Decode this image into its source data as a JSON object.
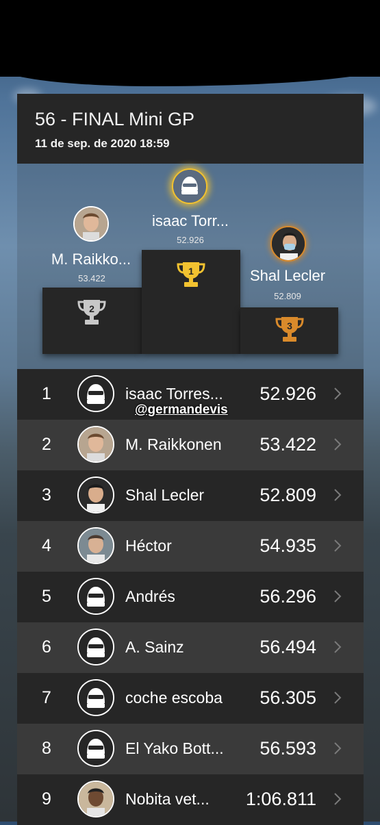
{
  "header": {
    "title": "56 - FINAL Mini GP",
    "date": "11 de sep. de 2020 18:59"
  },
  "podium": {
    "first": {
      "name": "isaac Torr...",
      "time": "52.926",
      "place": "1"
    },
    "second": {
      "name": "M. Raikko...",
      "time": "53.422",
      "place": "2"
    },
    "third": {
      "name": "Shal Lecler",
      "time": "52.809",
      "place": "3"
    }
  },
  "watermark": "@germandevis",
  "results": [
    {
      "rank": "1",
      "name": "isaac Torres...",
      "time": "52.926",
      "avatar": "helmet-icon"
    },
    {
      "rank": "2",
      "name": "M. Raikkonen",
      "time": "53.422",
      "avatar": "photo"
    },
    {
      "rank": "3",
      "name": "Shal Lecler",
      "time": "52.809",
      "avatar": "photo"
    },
    {
      "rank": "4",
      "name": "Héctor",
      "time": "54.935",
      "avatar": "photo"
    },
    {
      "rank": "5",
      "name": "Andrés",
      "time": "56.296",
      "avatar": "helmet-icon"
    },
    {
      "rank": "6",
      "name": "A. Sainz",
      "time": "56.494",
      "avatar": "helmet-icon"
    },
    {
      "rank": "7",
      "name": "coche escoba",
      "time": "56.305",
      "avatar": "helmet-icon"
    },
    {
      "rank": "8",
      "name": "El Yako Bott...",
      "time": "56.593",
      "avatar": "helmet-icon"
    },
    {
      "rank": "9",
      "name": "Nobita vet...",
      "time": "1:06.811",
      "avatar": "photo"
    }
  ],
  "colors": {
    "gold": "#f2c230",
    "silver": "#c8c8c8",
    "bronze": "#d98a2b",
    "row_dark": "#262626",
    "row_light": "#3a3a3a"
  }
}
